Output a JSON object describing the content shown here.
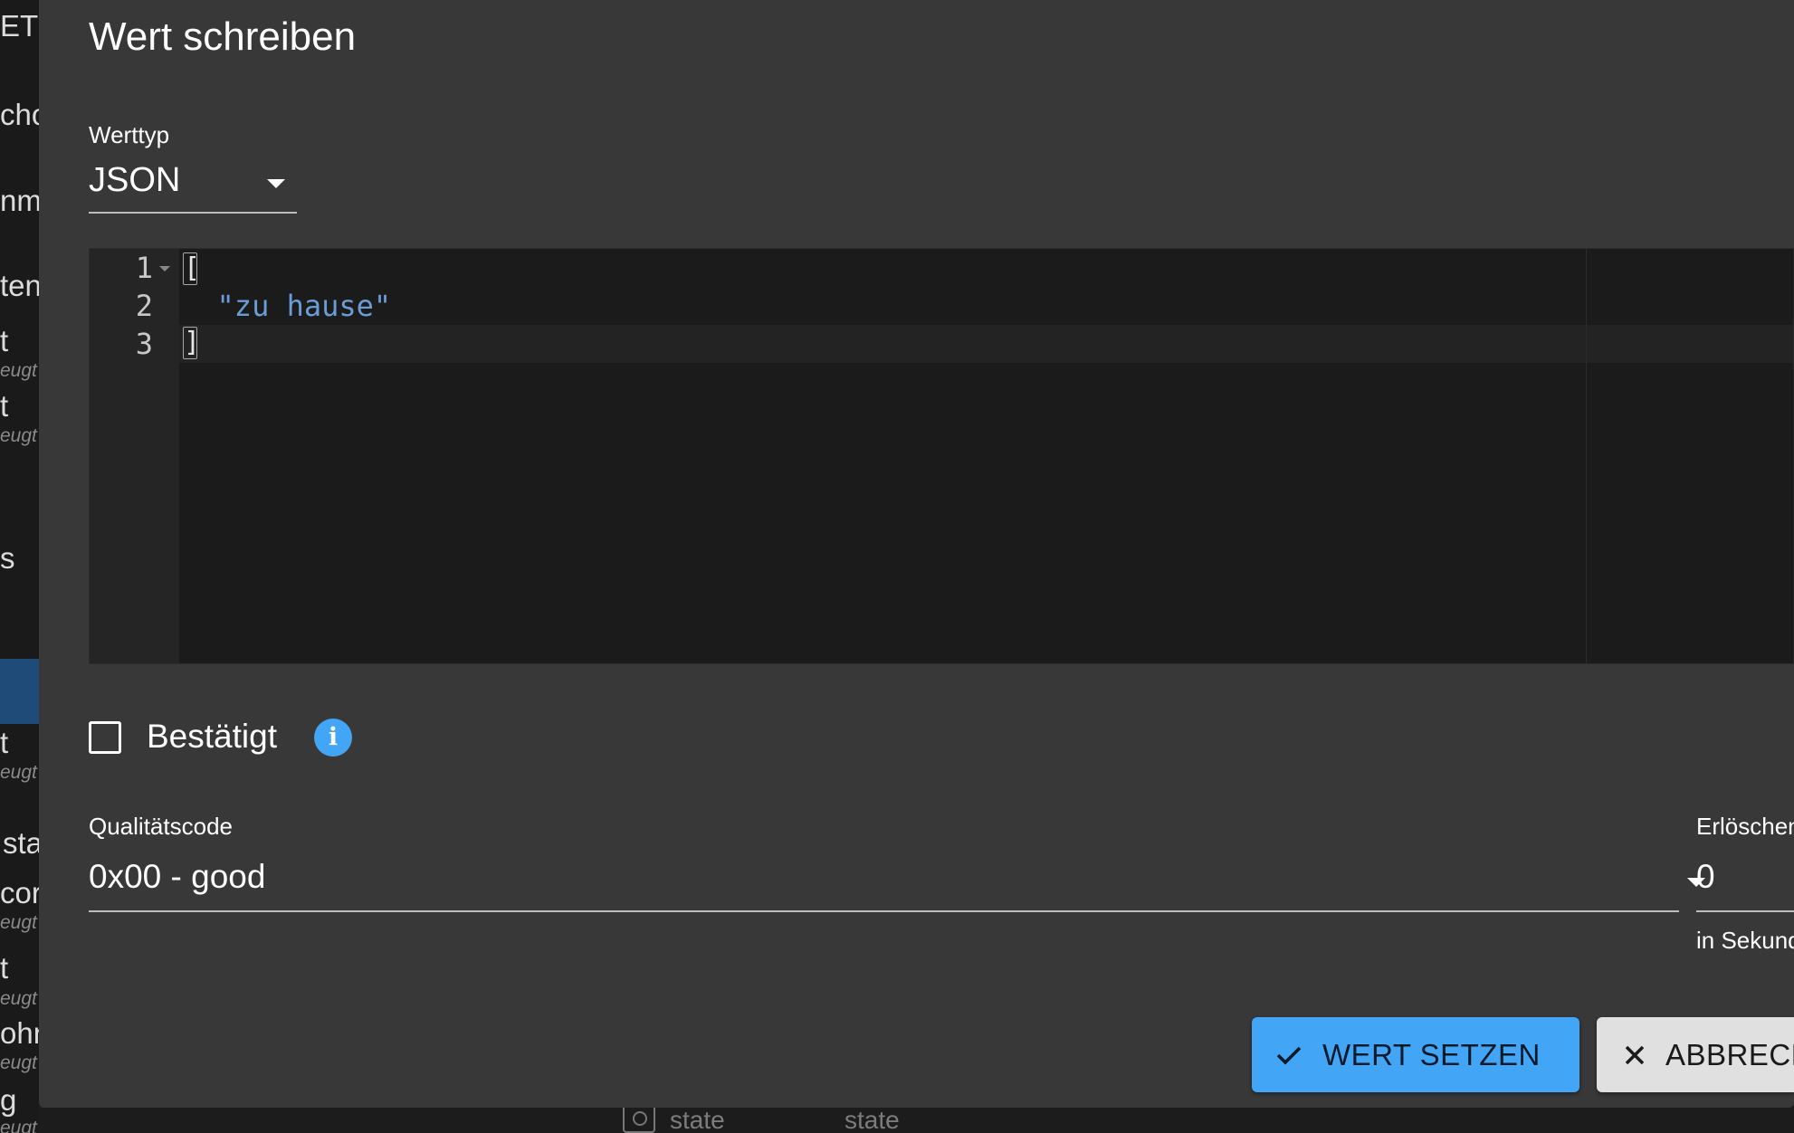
{
  "background": {
    "sidebar_fragments": [
      {
        "text": "ET",
        "small": false
      },
      {
        "text": "cho",
        "small": false
      },
      {
        "text": "nme",
        "small": false
      },
      {
        "text": "ten",
        "small": false
      },
      {
        "text": "t",
        "small": false
      },
      {
        "text": "eugt",
        "small": true
      },
      {
        "text": "t",
        "small": false
      },
      {
        "text": "eugt",
        "small": true
      },
      {
        "text": "s",
        "small": false
      },
      {
        "text": "t",
        "small": false
      },
      {
        "text": "eugt",
        "small": true
      },
      {
        "text": "sta",
        "small": false
      },
      {
        "text": "cor",
        "small": false
      },
      {
        "text": "eugt",
        "small": true
      },
      {
        "text": "t",
        "small": false
      },
      {
        "text": "eugt",
        "small": true
      },
      {
        "text": "ohn",
        "small": false
      },
      {
        "text": "eugt",
        "small": true
      },
      {
        "text": "g",
        "small": false
      },
      {
        "text": "eugt",
        "small": true
      }
    ],
    "bottom_fragments": [
      "state",
      "state"
    ]
  },
  "dialog": {
    "title": "Wert schreiben",
    "value_type": {
      "label": "Werttyp",
      "value": "JSON"
    },
    "editor": {
      "lines": [
        {
          "number": "1",
          "text": "["
        },
        {
          "number": "2",
          "text": "  \"zu hause\""
        },
        {
          "number": "3",
          "text": "]"
        }
      ]
    },
    "ack": {
      "label": "Bestätigt",
      "checked": false,
      "info_icon": "info-icon"
    },
    "quality": {
      "label": "Qualitätscode",
      "value": "0x00 - good"
    },
    "expire": {
      "label": "Erlöschen",
      "value": "0",
      "helper": "in Sekunden"
    },
    "buttons": {
      "set": {
        "label": "WERT SETZEN",
        "icon": "check-icon"
      },
      "cancel": {
        "label": "ABBRECHEN",
        "icon": "close-icon"
      }
    }
  },
  "colors": {
    "accent": "#42a5f5",
    "dialog_bg": "#383838",
    "editor_bg": "#1b1b1b",
    "string_token": "#6a9cd6"
  }
}
